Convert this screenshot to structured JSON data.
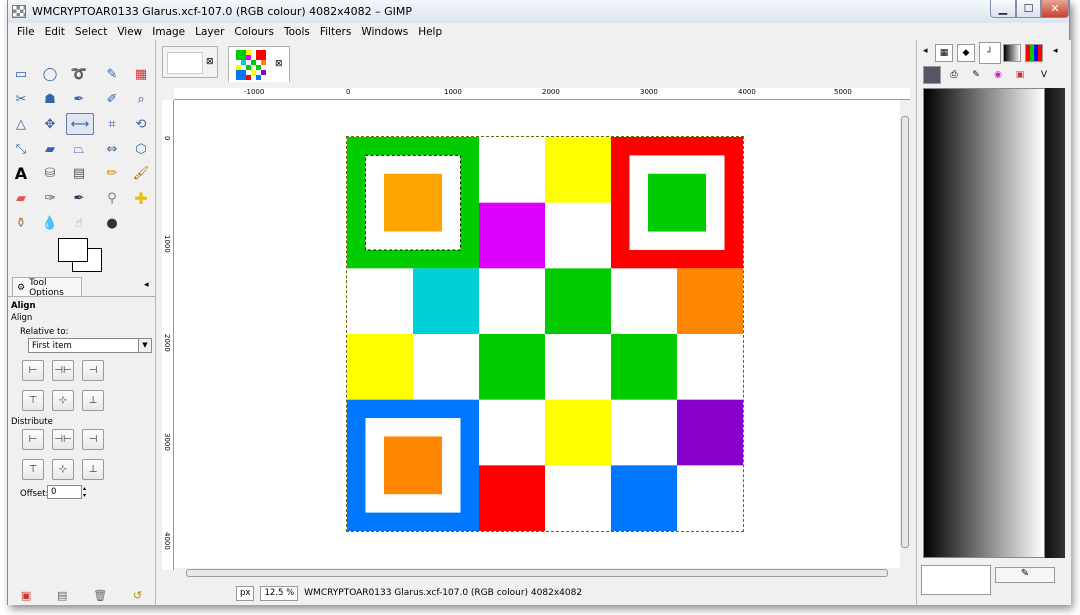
{
  "window": {
    "title": "WMCRYPTOAR0133 Glarus.xcf-107.0 (RGB colour) 4082x4082 – GIMP"
  },
  "menu": [
    "File",
    "Edit",
    "Select",
    "View",
    "Image",
    "Layer",
    "Colours",
    "Tools",
    "Filters",
    "Windows",
    "Help"
  ],
  "tool_options": {
    "tab_label": "Tool Options",
    "header": "Align",
    "subheader": "Align",
    "relative_to_label": "Relative to:",
    "relative_to_value": "First item",
    "distribute_label": "Distribute",
    "offset_label": "Offset:",
    "offset_value": "0"
  },
  "ruler_top": [
    "-1000",
    "0",
    "1000",
    "2000",
    "3000",
    "4000",
    "5000"
  ],
  "ruler_left": [
    "0",
    "1000",
    "2000",
    "3000",
    "4000"
  ],
  "status": {
    "unit": "px",
    "zoom": "12.5 %",
    "text": "WMCRYPTOAR0133 Glarus.xcf-107.0 (RGB colour) 4082x4082"
  },
  "colors": {
    "green": "#00cc00",
    "red": "#ff0000",
    "blue": "#0077ff",
    "orange": "#ffa500",
    "orange2": "#ff8800",
    "yellow": "#ffff00",
    "magenta": "#dd00ff",
    "cyan": "#00d0d8",
    "purple": "#8800cc"
  }
}
